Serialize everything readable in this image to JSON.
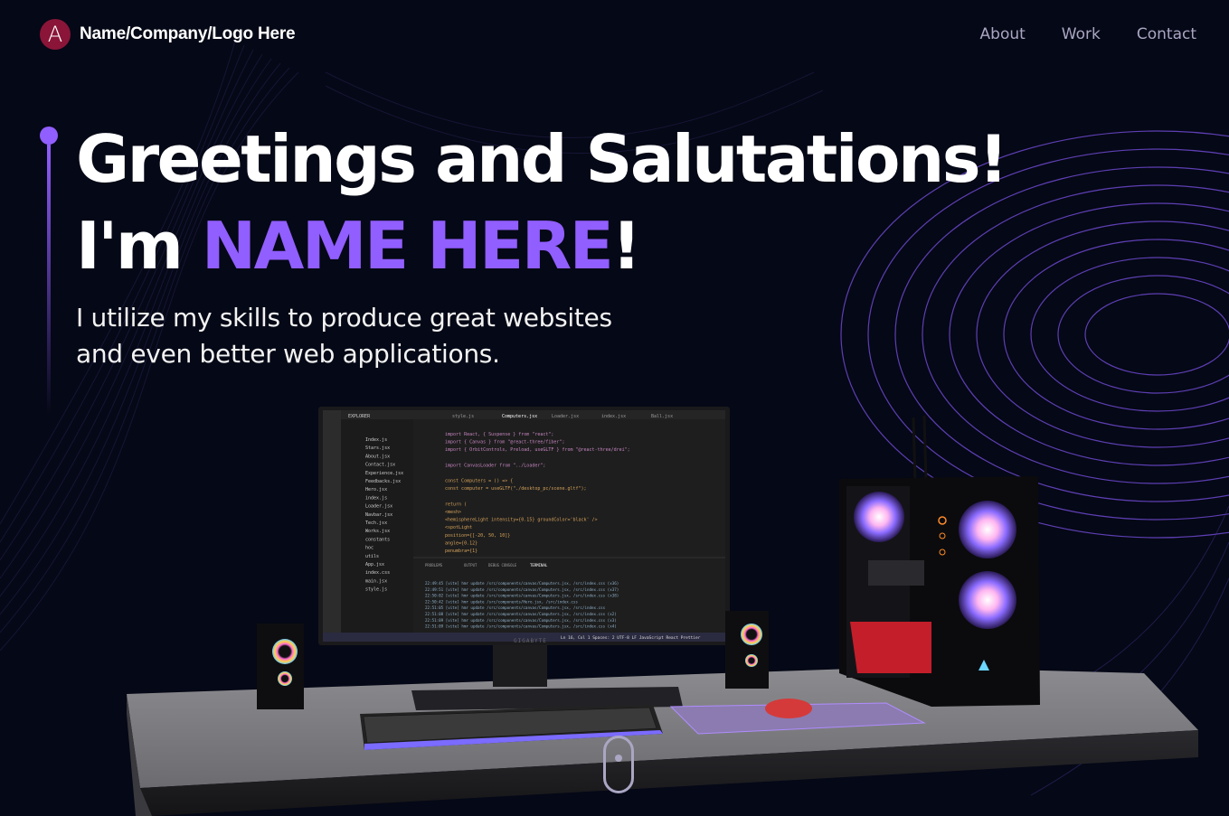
{
  "brand": {
    "logo_letter": "A",
    "name": "Name/Company/Logo Here"
  },
  "nav": {
    "links": [
      "About",
      "Work",
      "Contact"
    ]
  },
  "hero": {
    "title_line1": "Greetings and Salutations!",
    "title_prefix": "I'm ",
    "title_name": "NAME HERE",
    "title_suffix": "!",
    "subtitle_line1": "I utilize my skills to produce great websites",
    "subtitle_line2": "and even better web applications."
  },
  "monitor": {
    "brand": "GIGABYTE",
    "tabs": [
      "style.js",
      "Computers.jsx",
      "Loader.jsx",
      "index.jsx",
      "Ball.jsx"
    ],
    "explorer_title": "EXPLORER",
    "files": [
      "Index.js",
      "Stars.jsx",
      "About.jsx",
      "Contact.jsx",
      "Experience.jsx",
      "Feedbacks.jsx",
      "Hero.jsx",
      "index.js",
      "Loader.jsx",
      "Navbar.jsx",
      "Tech.jsx",
      "Works.jsx",
      "constants",
      "hoc",
      "utils",
      "App.jsx",
      "index.css",
      "main.jsx",
      "style.js"
    ],
    "code_lines": [
      "import React, { Suspense } from \"react\";",
      "import { Canvas } from \"@react-three/fiber\";",
      "import { OrbitControls, Preload, useGLTF } from \"@react-three/drei\";",
      "",
      "import CanvasLoader from \"../Loader\";",
      "",
      "const Computers = () => {",
      "  const computer = useGLTF(\"./desktop_pc/scene.gltf\");",
      "",
      "  return (",
      "    <mesh>",
      "      <hemisphereLight intensity={0.15} groundColor='black' />",
      "      <spotLight",
      "        position={[-20, 50, 10]}",
      "        angle={0.12}",
      "        penumbra={1}"
    ],
    "panel_tabs": [
      "PROBLEMS",
      "OUTPUT",
      "DEBUG CONSOLE",
      "TERMINAL"
    ],
    "terminal_lines": [
      "22:49:45 [vite] hmr update /src/components/canvas/Computers.jsx, /src/index.css (x36)",
      "22:49:51 [vite] hmr update /src/components/canvas/Computers.jsx, /src/index.css (x37)",
      "22:50:02 [vite] hmr update /src/components/canvas/Computers.jsx, /src/index.css (x38)",
      "22:50:42 [vite] hmr update /src/components/Hero.jsx, /src/index.css",
      "22:51:05 [vite] hmr update /src/components/canvas/Computers.jsx, /src/index.css",
      "22:51:08 [vite] hmr update /src/components/canvas/Computers.jsx, /src/index.css (x2)",
      "22:51:09 [vite] hmr update /src/components/canvas/Computers.jsx, /src/index.css (x3)",
      "22:51:09 [vite] hmr update /src/components/canvas/Computers.jsx, /src/index.css (x4)"
    ],
    "status_bar": "Ln 16, Col 1   Spaces: 2   UTF-8   LF   JavaScript React   Prettier"
  },
  "colors": {
    "background": "#050816",
    "accent": "#915eff",
    "secondary_text": "#aaa6c3",
    "logo_bg": "#8a1538"
  },
  "icons": [
    "logo-letter-icon",
    "scroll-mouse-icon"
  ]
}
